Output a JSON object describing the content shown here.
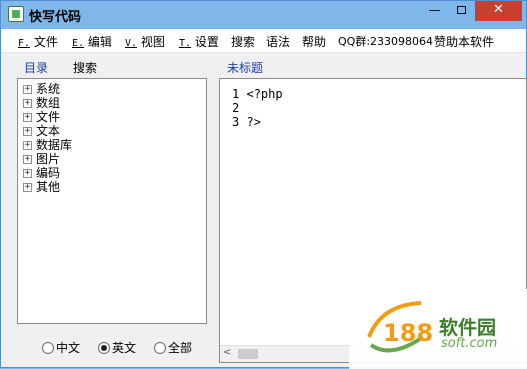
{
  "window": {
    "title": "快写代码",
    "controls": {
      "minimize": "—",
      "close": "✕"
    }
  },
  "menu": [
    {
      "mnemonic": "F.",
      "label": "文件"
    },
    {
      "mnemonic": "E.",
      "label": "编辑"
    },
    {
      "mnemonic": "V.",
      "label": "视图"
    },
    {
      "mnemonic": "T.",
      "label": "设置"
    },
    {
      "label": "搜索"
    },
    {
      "label": "语法"
    },
    {
      "label": "帮助"
    },
    {
      "label": "QQ群:233098064"
    },
    {
      "label": "赞助本软件"
    }
  ],
  "left_panel": {
    "tab_directory": "目录",
    "tab_search": "搜索",
    "tree": [
      {
        "expander": "+",
        "label": "系统"
      },
      {
        "expander": "+",
        "label": "数组"
      },
      {
        "expander": "+",
        "label": "文件"
      },
      {
        "expander": "+",
        "label": "文本"
      },
      {
        "expander": "+",
        "label": "数据库"
      },
      {
        "expander": "+",
        "label": "图片"
      },
      {
        "expander": "+",
        "label": "编码"
      },
      {
        "expander": "+",
        "label": "其他"
      }
    ],
    "language_options": [
      {
        "label": "中文",
        "checked": false
      },
      {
        "label": "英文",
        "checked": true
      },
      {
        "label": "全部",
        "checked": false
      }
    ]
  },
  "editor": {
    "tab_title": "未标题",
    "lines": [
      {
        "num": "1",
        "text": "<?php"
      },
      {
        "num": "2",
        "text": ""
      },
      {
        "num": "3",
        "text": "?>"
      }
    ],
    "scroll_left_glyph": "<"
  },
  "watermark": {
    "logo_number": "188",
    "brand": "软件园",
    "domain": "soft.com",
    "colors": {
      "orange": "#f39c12",
      "green": "#3a7d2a"
    }
  }
}
